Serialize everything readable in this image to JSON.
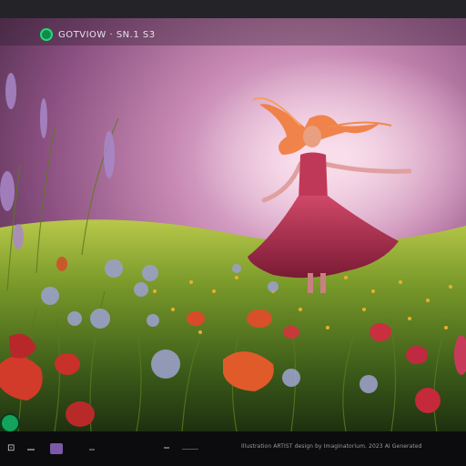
{
  "viewer": {
    "overlay_title": "GOTVIOW  ·  SN.1 S3"
  },
  "footer": {
    "left_glyph": "⊡",
    "credit": "Illustration ARTIST design by Imaginatorium. 2023 AI Generated"
  },
  "icons": {
    "logo": "circle-logo-icon",
    "badge": "green-badge-icon",
    "thumb": "image-thumbnail-icon"
  },
  "colors": {
    "sky": "#9a5c8a",
    "meadow": "#7a9a2a",
    "dress": "#b02a48",
    "hair": "#f07a3a",
    "accent": "#13a35a"
  }
}
